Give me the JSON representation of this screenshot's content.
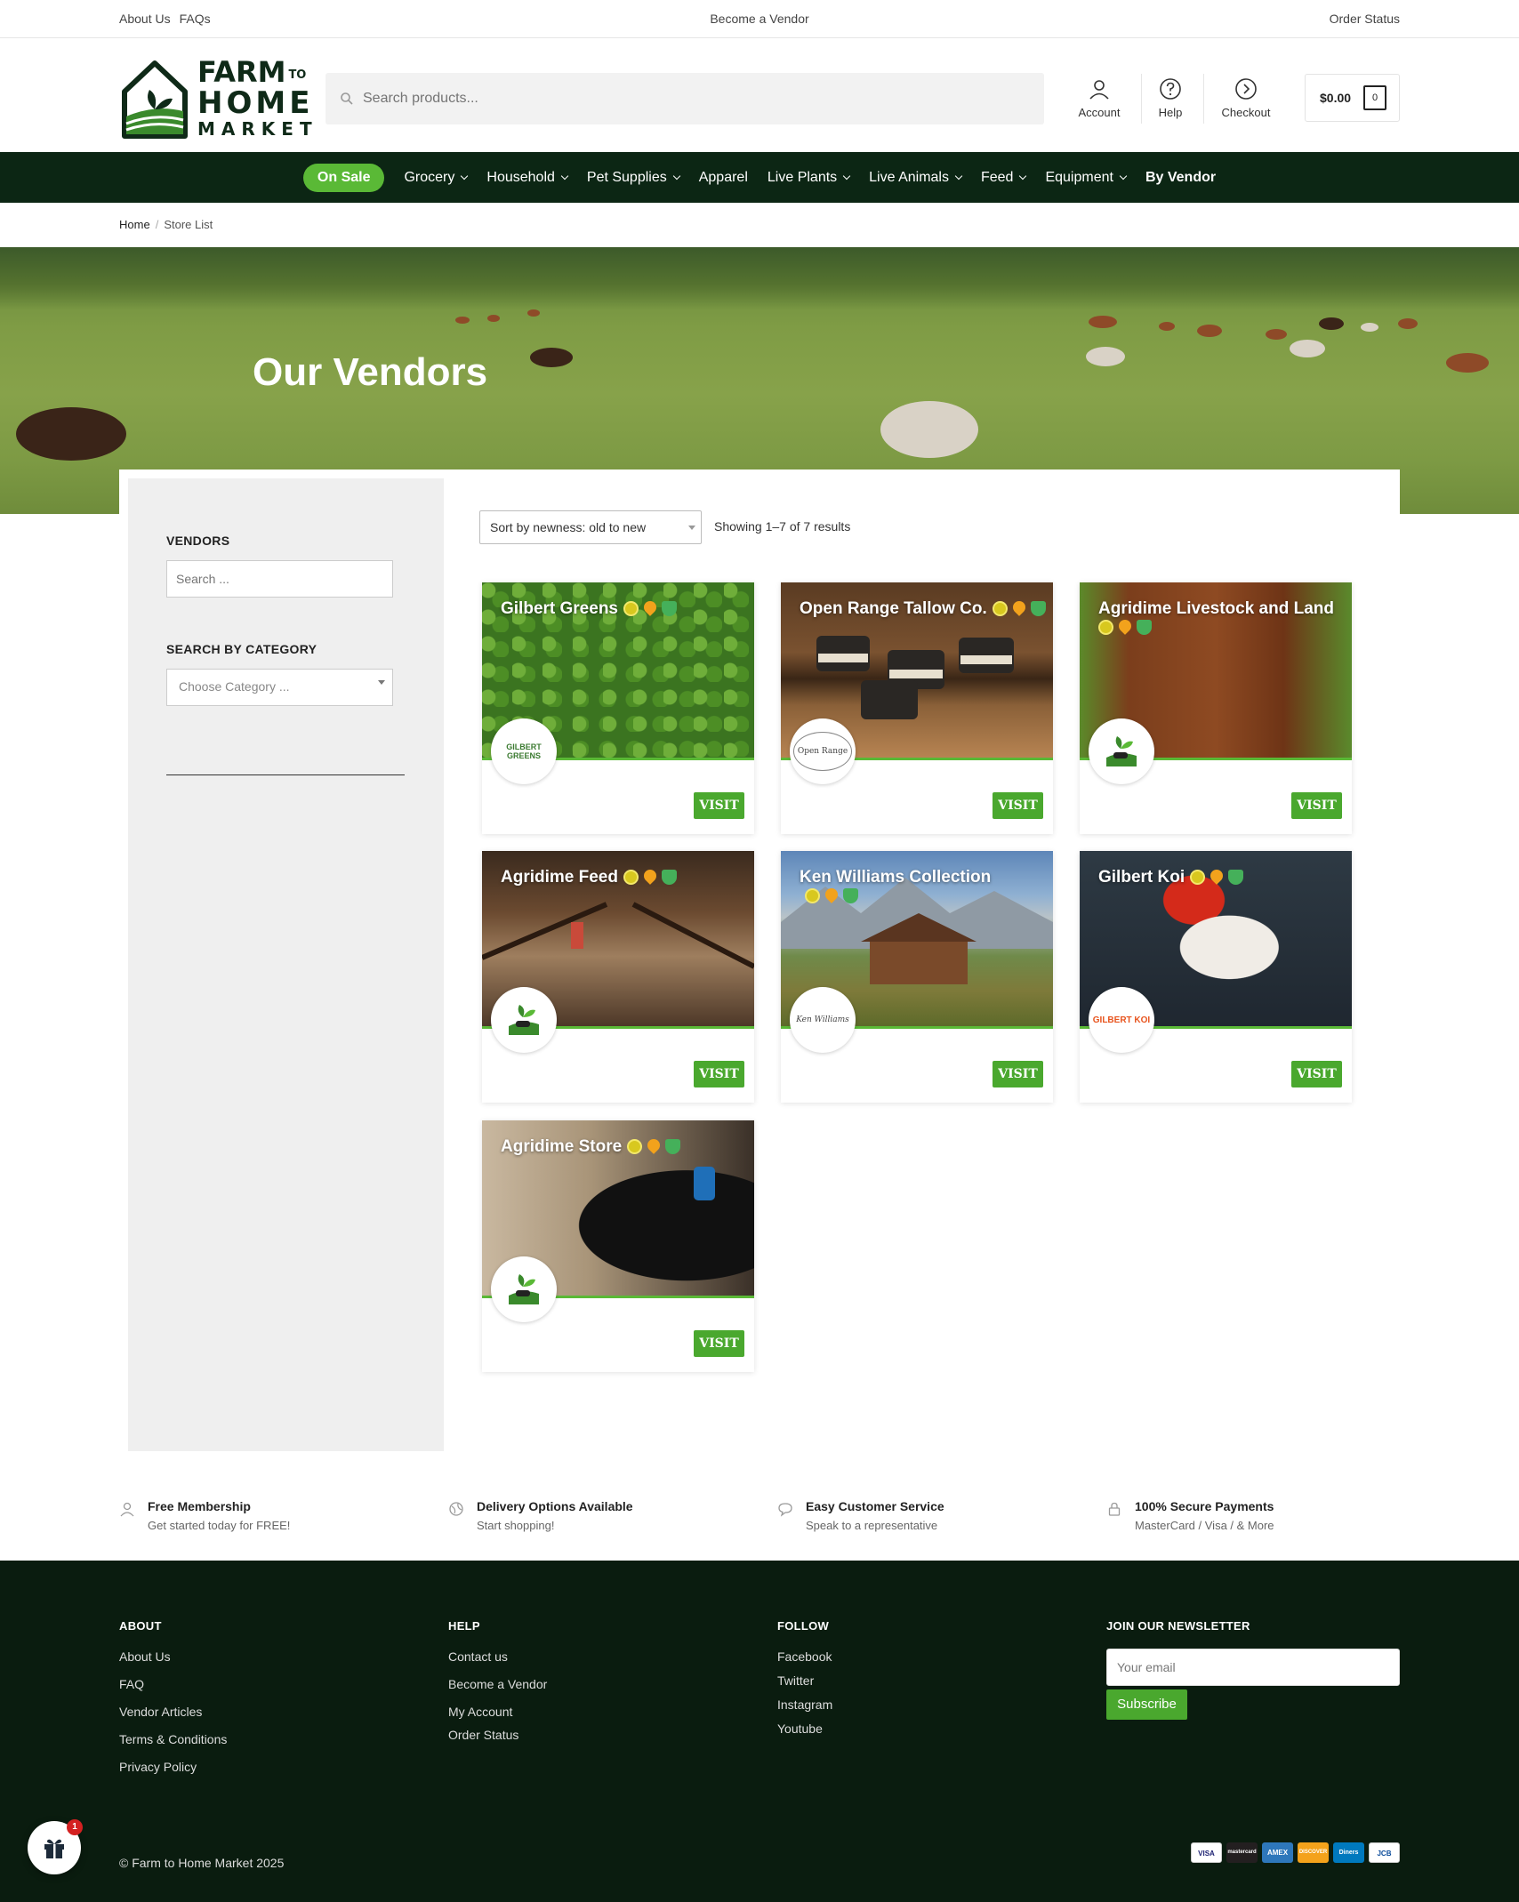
{
  "topbar": {
    "links_left": [
      "About Us",
      "FAQs"
    ],
    "center_link": "Become a Vendor",
    "right_link": "Order Status"
  },
  "brand": {
    "line1": "FARM",
    "line1_small": "TO",
    "line2": "HOME",
    "line3": "MARKET",
    "primary_color": "#0c2614",
    "accent_color": "#5ab936"
  },
  "search": {
    "placeholder": "Search products...",
    "icon": "search-icon"
  },
  "header_links": [
    {
      "label": "Account",
      "icon": "user-icon"
    },
    {
      "label": "Help",
      "icon": "question-icon"
    },
    {
      "label": "Checkout",
      "icon": "arrow-circle-icon"
    }
  ],
  "cart": {
    "total": "$0.00",
    "count": "0"
  },
  "nav": {
    "sale": "On Sale",
    "items": [
      {
        "label": "Grocery",
        "dropdown": true
      },
      {
        "label": "Household",
        "dropdown": true
      },
      {
        "label": "Pet Supplies",
        "dropdown": true
      },
      {
        "label": "Apparel",
        "dropdown": false
      },
      {
        "label": "Live Plants",
        "dropdown": true
      },
      {
        "label": "Live Animals",
        "dropdown": true
      },
      {
        "label": "Feed",
        "dropdown": true
      },
      {
        "label": "Equipment",
        "dropdown": true
      }
    ],
    "by_vendor": "By Vendor"
  },
  "breadcrumb": {
    "home": "Home",
    "sep": "/",
    "current": "Store List"
  },
  "hero": {
    "title": "Our Vendors"
  },
  "sidebar": {
    "vendors_title": "VENDORS",
    "search_placeholder": "Search ...",
    "category_title": "SEARCH BY CATEGORY",
    "category_placeholder": "Choose Category ..."
  },
  "listing": {
    "sort": "Sort by newness: old to new",
    "results": "Showing 1–7 of 7 results",
    "visit_label": "VISIT"
  },
  "vendors": [
    {
      "name": "Gilbert Greens",
      "logo": "GILBERT GREENS"
    },
    {
      "name": "Open Range Tallow Co.",
      "logo": "Open Range"
    },
    {
      "name": "Agridime Livestock and Land",
      "logo": ""
    },
    {
      "name": "Agridime Feed",
      "logo": ""
    },
    {
      "name": "Ken Williams Collection",
      "logo": "Ken Williams"
    },
    {
      "name": "Gilbert Koi",
      "logo": "GILBERT KOI"
    },
    {
      "name": "Agridime Store",
      "logo": ""
    }
  ],
  "features": [
    {
      "title": "Free Membership",
      "sub": "Get started today for FREE!",
      "icon": "user-icon"
    },
    {
      "title": "Delivery Options Available",
      "sub": "Start shopping!",
      "icon": "globe-icon"
    },
    {
      "title": "Easy Customer Service",
      "sub": "Speak to a representative",
      "icon": "chat-icon"
    },
    {
      "title": "100% Secure Payments",
      "sub": "MasterCard / Visa / & More",
      "icon": "lock-icon"
    }
  ],
  "footer": {
    "about": {
      "title": "ABOUT",
      "links": [
        "About Us",
        "FAQ",
        "Vendor Articles",
        "Terms & Conditions",
        "Privacy Policy"
      ]
    },
    "help": {
      "title": "HELP",
      "links": [
        "Contact us",
        "Become a Vendor",
        "My Account",
        "Order Status"
      ]
    },
    "follow": {
      "title": "FOLLOW",
      "links": [
        "Facebook",
        "Twitter",
        "Instagram",
        "Youtube"
      ]
    },
    "newsletter": {
      "title": "JOIN OUR NEWSLETTER",
      "placeholder": "Your email",
      "button": "Subscribe"
    },
    "copyright": "© Farm to Home Market 2025",
    "payments": [
      "VISA",
      "mastercard",
      "AMEX",
      "DISCOVER",
      "Diners",
      "JCB"
    ]
  },
  "gift_widget": {
    "count": "1"
  }
}
